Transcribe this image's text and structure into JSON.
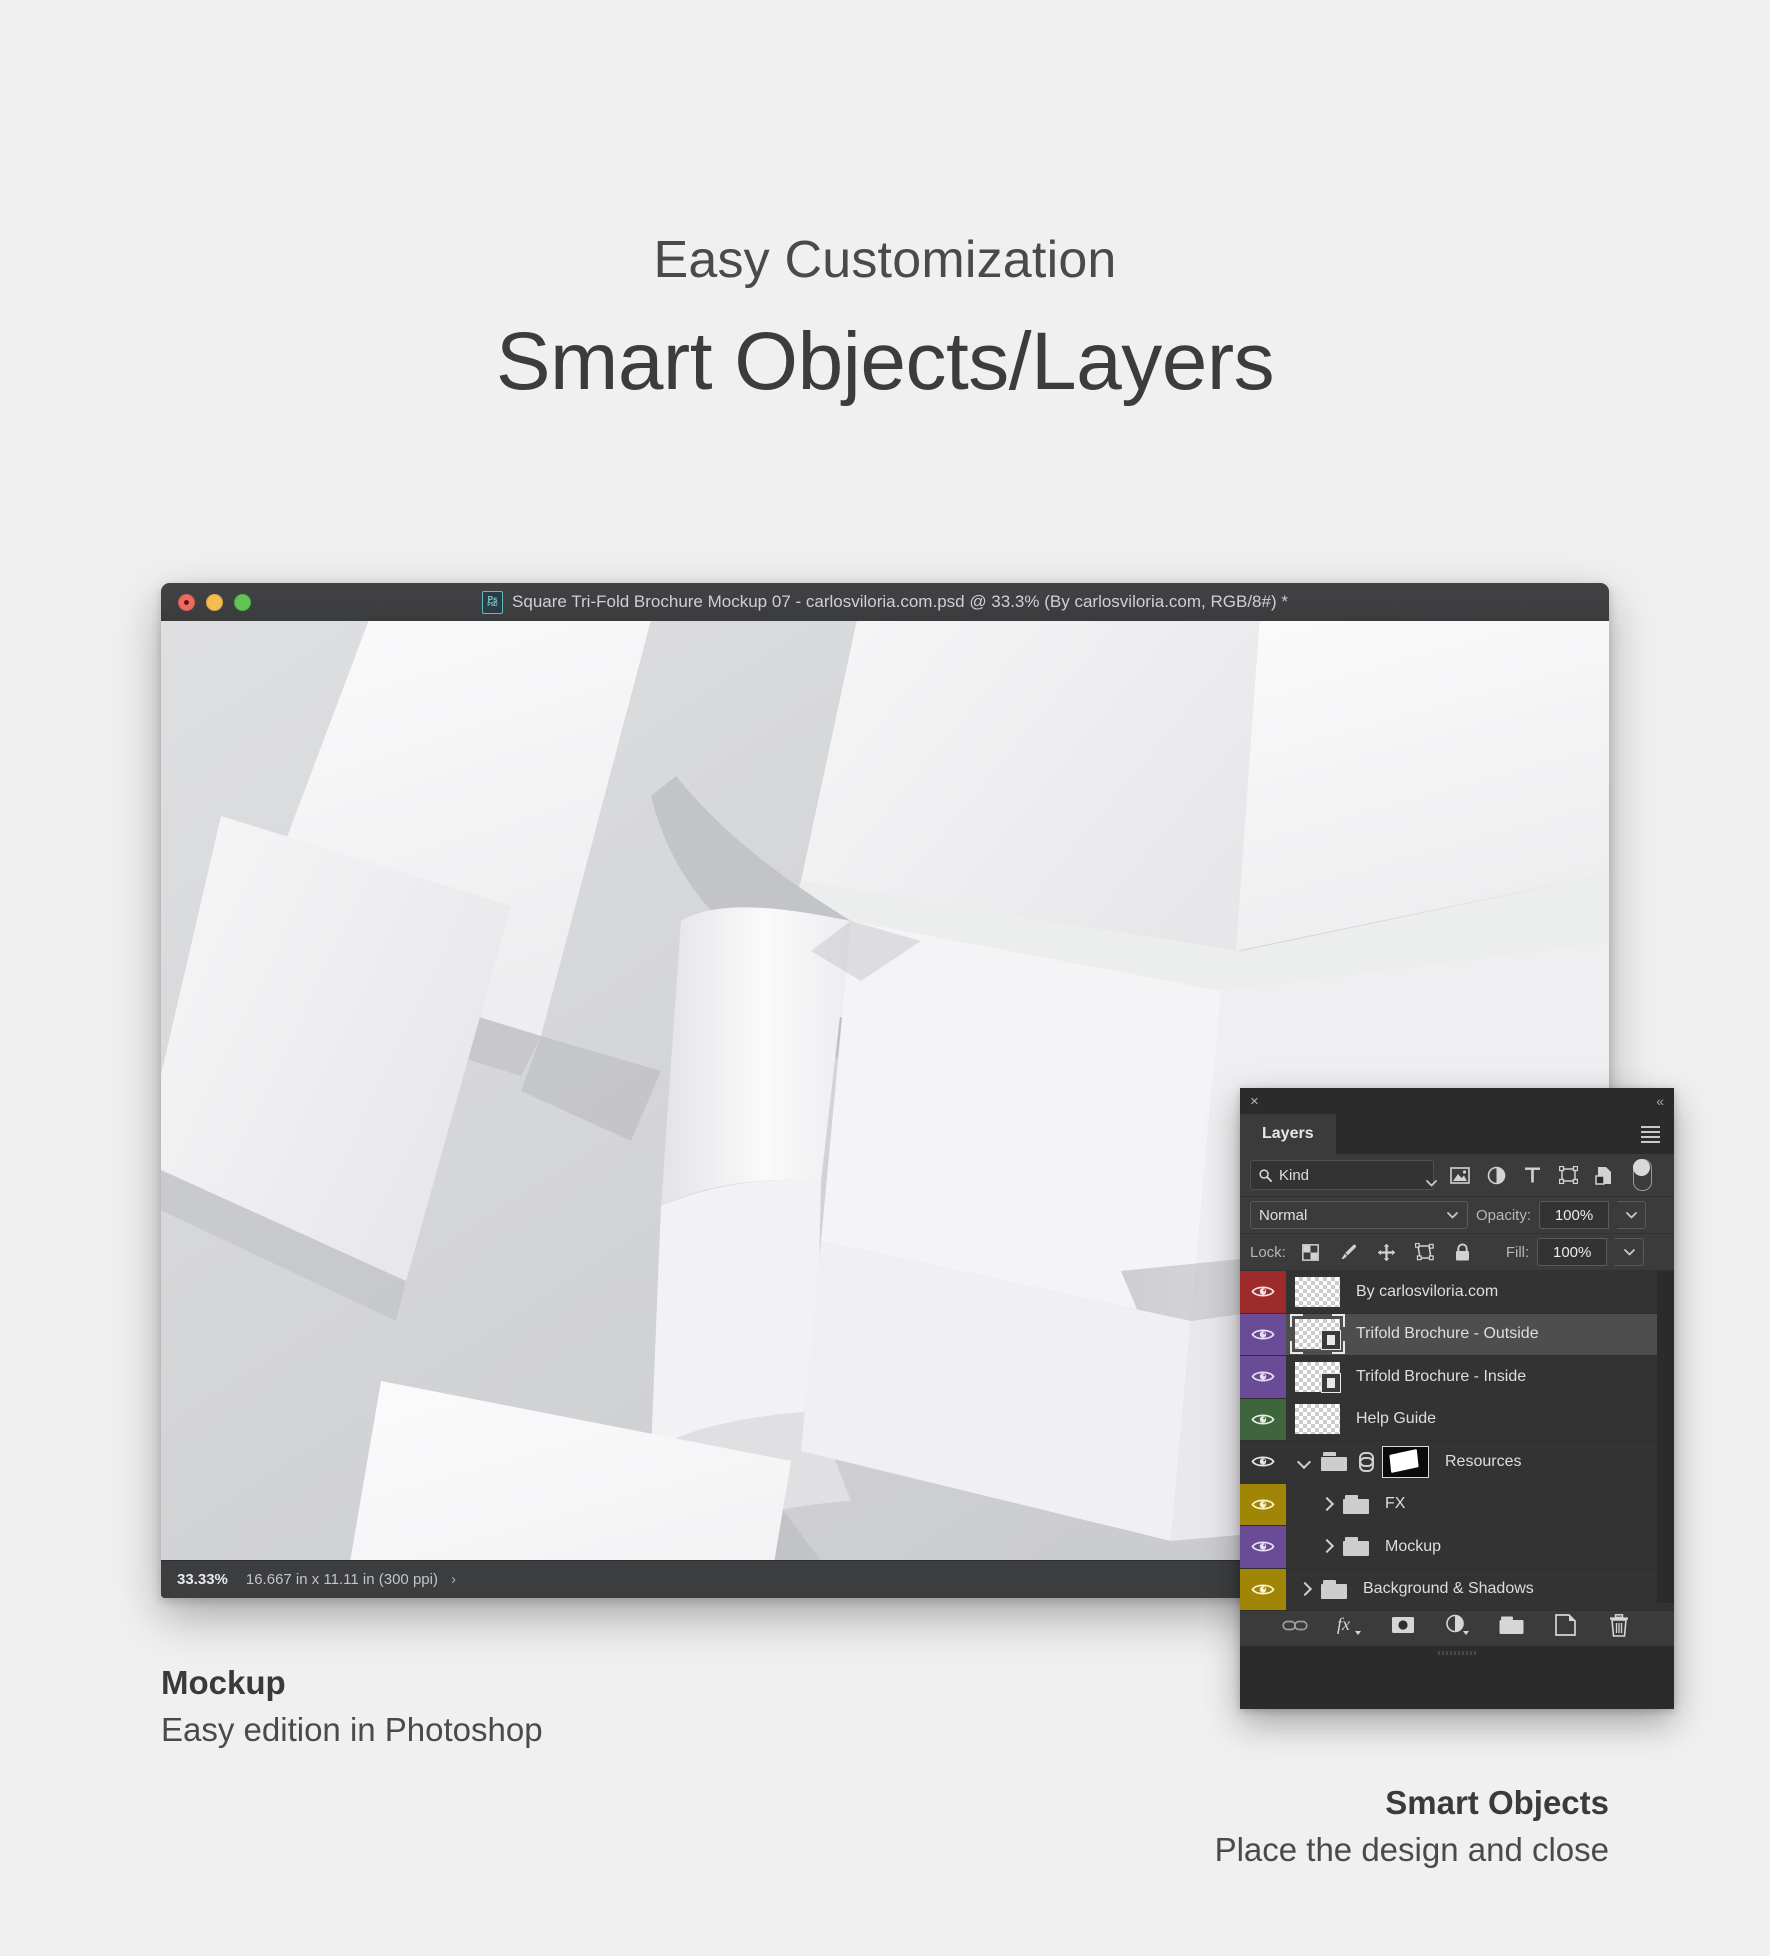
{
  "headings": {
    "eyebrow": "Easy Customization",
    "title": "Smart Objects/Layers"
  },
  "photoshop_window": {
    "title": "Square Tri-Fold Brochure Mockup 07 - carlosviloria.com.psd @ 33.3% (By carlosviloria.com, RGB/8#) *",
    "doc_icon_label": "Ps",
    "doc_icon_sublabel": "PSD",
    "traffic_lights": [
      "close-red",
      "minimize-yellow",
      "zoom-green"
    ],
    "status": {
      "zoom": "33.33%",
      "dimensions": "16.667 in x 11.11 in (300 ppi)",
      "arrow": "›"
    }
  },
  "layers_panel": {
    "close_icon": "×",
    "collapse_icon": "«",
    "tab_label": "Layers",
    "menu_icon": "panel-menu-icon",
    "filter": {
      "kind_label": "Kind",
      "search_icon": "magnifier-icon",
      "icons": [
        "pixel-layer-filter",
        "adjustment-layer-filter",
        "type-layer-filter",
        "shape-layer-filter",
        "smart-object-filter"
      ],
      "toggle_icon": "filter-toggle-switch"
    },
    "blend": {
      "mode": "Normal",
      "opacity_label": "Opacity:",
      "opacity_value": "100%"
    },
    "lock": {
      "label": "Lock:",
      "icons": [
        "lock-transparent-pixels",
        "lock-image-pixels",
        "lock-position",
        "lock-artboard-nesting",
        "lock-all"
      ],
      "fill_label": "Fill:",
      "fill_value": "100%"
    },
    "layers": [
      {
        "name": "By carlosviloria.com",
        "tag_color": "#9e2b2b",
        "type": "pixel",
        "selected": false,
        "indent": 0
      },
      {
        "name": "Trifold Brochure - Outside",
        "tag_color": "#6a4b96",
        "type": "smart-object",
        "selected": true,
        "indent": 0
      },
      {
        "name": "Trifold Brochure - Inside",
        "tag_color": "#6a4b96",
        "type": "smart-object",
        "selected": false,
        "indent": 0
      },
      {
        "name": "Help Guide",
        "tag_color": "#3f653c",
        "type": "pixel",
        "selected": false,
        "indent": 0
      },
      {
        "name": "Resources",
        "tag_color": "#333333",
        "type": "group-open-linked",
        "selected": false,
        "indent": 0
      },
      {
        "name": "FX",
        "tag_color": "#a08507",
        "type": "group",
        "selected": false,
        "indent": 1
      },
      {
        "name": "Mockup",
        "tag_color": "#6a4b96",
        "type": "group",
        "selected": false,
        "indent": 1
      },
      {
        "name": "Background & Shadows",
        "tag_color": "#a08507",
        "type": "group",
        "selected": false,
        "indent": 0
      }
    ],
    "bottom_icons": [
      "link-layers-icon",
      "layer-style-fx-icon",
      "layer-mask-icon",
      "adjustment-layer-icon",
      "new-group-icon",
      "new-layer-icon",
      "delete-layer-icon"
    ],
    "fx_label": "fx"
  },
  "captions": {
    "left": {
      "title": "Mockup",
      "subtitle": "Easy edition in Photoshop"
    },
    "right": {
      "title": "Smart Objects",
      "subtitle": "Place the design and close"
    }
  },
  "colors": {
    "page_bg": "#f0f0f0",
    "panel_bg": "#2b2b2b",
    "panel_row": "#333333",
    "panel_row_selected": "#4e4e4e",
    "titlebar": "#3a3b3d"
  }
}
